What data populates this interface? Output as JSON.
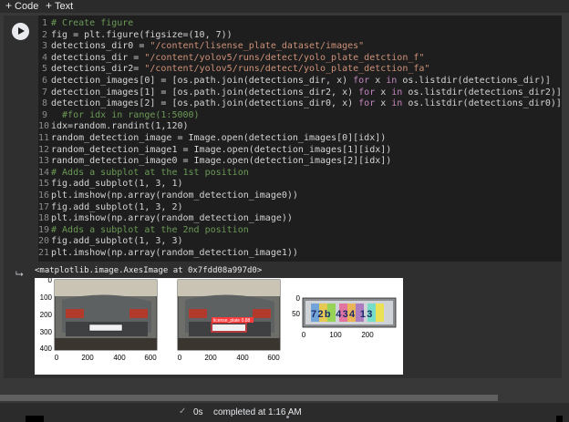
{
  "toolbar": {
    "code_label": "Code",
    "text_label": "Text"
  },
  "code_lines": [
    {
      "n": "1",
      "parts": [
        {
          "t": "# ",
          "c": "cm"
        },
        {
          "t": "Create figure",
          "c": "cm"
        }
      ]
    },
    {
      "n": "2",
      "parts": [
        {
          "t": "fig = plt.figure(figsize=(10, 7))",
          "c": ""
        }
      ]
    },
    {
      "n": "3",
      "parts": [
        {
          "t": "detections_dir0 = ",
          "c": ""
        },
        {
          "t": "\"/content/lisense_plate_dataset/images\"",
          "c": "str"
        }
      ]
    },
    {
      "n": "4",
      "parts": [
        {
          "t": "detections_dir = ",
          "c": ""
        },
        {
          "t": "\"/content/yolov5/runs/detect/yolo_plate_detction_f\"",
          "c": "str"
        }
      ]
    },
    {
      "n": "5",
      "parts": [
        {
          "t": "detections_dir2= ",
          "c": ""
        },
        {
          "t": "\"/content/yolov5/runs/detect/yolo_plate_detction_fa\"",
          "c": "str"
        }
      ]
    },
    {
      "n": "6",
      "parts": [
        {
          "t": "detection_images[0] = [os.path.join(detections_dir, x) ",
          "c": ""
        },
        {
          "t": "for",
          "c": "kw"
        },
        {
          "t": " x ",
          "c": ""
        },
        {
          "t": "in",
          "c": "kw"
        },
        {
          "t": " os.listdir(detections_dir)]",
          "c": ""
        }
      ]
    },
    {
      "n": "7",
      "parts": [
        {
          "t": "detection_images[1] = [os.path.join(detections_dir2, x) ",
          "c": ""
        },
        {
          "t": "for",
          "c": "kw"
        },
        {
          "t": " x ",
          "c": ""
        },
        {
          "t": "in",
          "c": "kw"
        },
        {
          "t": " os.listdir(detections_dir2)]",
          "c": ""
        }
      ]
    },
    {
      "n": "8",
      "parts": [
        {
          "t": "detection_images[2] = [os.path.join(detections_dir0, x) ",
          "c": ""
        },
        {
          "t": "for",
          "c": "kw"
        },
        {
          "t": " x ",
          "c": ""
        },
        {
          "t": "in",
          "c": "kw"
        },
        {
          "t": " os.listdir(detections_dir0)]",
          "c": ""
        }
      ]
    },
    {
      "n": "9",
      "parts": [
        {
          "t": "  #for idx in range(1:5000)",
          "c": "cm"
        }
      ]
    },
    {
      "n": "10",
      "parts": [
        {
          "t": "idx=random.randint(1,120)",
          "c": ""
        }
      ]
    },
    {
      "n": "11",
      "parts": [
        {
          "t": "random_detection_image = Image.open(detection_images[0][idx])",
          "c": ""
        }
      ]
    },
    {
      "n": "12",
      "parts": [
        {
          "t": "random_detection_image1 = Image.open(detection_images[1][idx])",
          "c": ""
        }
      ]
    },
    {
      "n": "13",
      "parts": [
        {
          "t": "random_detection_image0 = Image.open(detection_images[2][idx])",
          "c": ""
        }
      ]
    },
    {
      "n": "14",
      "parts": [
        {
          "t": "# Adds a subplot at the 1st position",
          "c": "cm"
        }
      ]
    },
    {
      "n": "15",
      "parts": [
        {
          "t": "fig.add_subplot(1, 3, 1)",
          "c": ""
        }
      ]
    },
    {
      "n": "16",
      "parts": [
        {
          "t": "plt.imshow(np.array(random_detection_image0))",
          "c": ""
        }
      ]
    },
    {
      "n": "17",
      "parts": [
        {
          "t": "fig.add_subplot(1, 3, 2)",
          "c": ""
        }
      ]
    },
    {
      "n": "18",
      "parts": [
        {
          "t": "plt.imshow(np.array(random_detection_image))",
          "c": ""
        }
      ]
    },
    {
      "n": "19",
      "parts": [
        {
          "t": "# Adds a subplot at the 2nd position",
          "c": "cm"
        }
      ]
    },
    {
      "n": "20",
      "parts": [
        {
          "t": "fig.add_subplot(1, 3, 3)",
          "c": ""
        }
      ]
    },
    {
      "n": "21",
      "parts": [
        {
          "t": "plt.imshow(np.array(random_detection_image1))",
          "c": ""
        }
      ]
    }
  ],
  "output": {
    "text": "<matplotlib.image.AxesImage at 0x7fdd08a997d0>",
    "plot1": {
      "yticks": [
        "0",
        "100",
        "200",
        "300",
        "400"
      ],
      "xticks": [
        "0",
        "200",
        "400",
        "600"
      ]
    },
    "plot2": {
      "xticks": [
        "0",
        "200",
        "400",
        "600"
      ],
      "box_label": "license_plate 0.88"
    },
    "plot3": {
      "yticks": [
        "0",
        "50"
      ],
      "xticks": [
        "0",
        "100",
        "200"
      ],
      "plate_text": "72b 434 13"
    }
  },
  "status": {
    "elapsed": "0s",
    "message": "completed at 1:16 AM"
  },
  "colors": {
    "check": "#9aa0a6",
    "box": "#ff3b3b"
  }
}
